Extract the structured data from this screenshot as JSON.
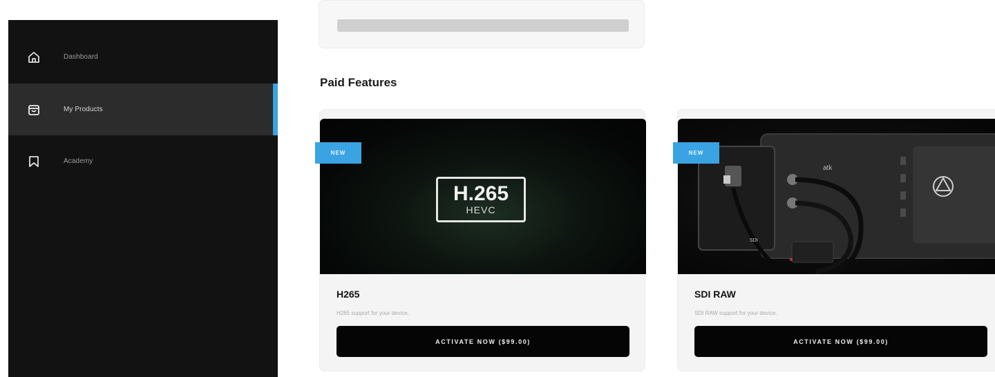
{
  "sidebar": {
    "items": [
      {
        "label": "Dashboard",
        "icon": "home-icon",
        "active": false
      },
      {
        "label": "My Products",
        "icon": "shopping-bag-icon",
        "active": true
      },
      {
        "label": "Academy",
        "icon": "bookmark-icon",
        "active": false
      }
    ],
    "accent_color": "#3aa3e3"
  },
  "main": {
    "section_title": "Paid Features",
    "cards": [
      {
        "badge": "NEW",
        "media_logo_main": "H.265",
        "media_logo_sub": "HEVC",
        "title": "H265",
        "description": "H265 support for your device.",
        "button_label": "ACTIVATE NOW ($99.00)"
      },
      {
        "badge": "NEW",
        "media_image": "monitor-with-sdi-cables",
        "title": "SDI RAW",
        "description": "SDI RAW support for your device.",
        "button_label": "ACTIVATE NOW ($99.00)"
      }
    ]
  }
}
